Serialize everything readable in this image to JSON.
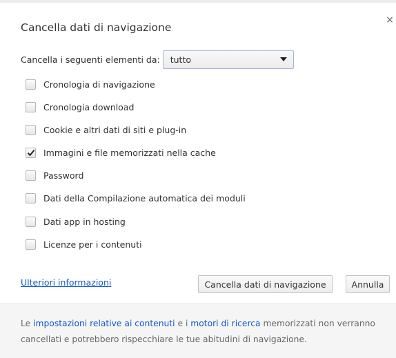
{
  "dialog": {
    "title": "Cancella dati di navigazione",
    "close_glyph": "×",
    "close_icon": "close-icon"
  },
  "period": {
    "label": "Cancella i seguenti elementi da:",
    "selected": "tutto",
    "caret_icon": "chevron-down-icon"
  },
  "options": [
    {
      "label": "Cronologia di navigazione",
      "checked": false
    },
    {
      "label": "Cronologia download",
      "checked": false
    },
    {
      "label": "Cookie e altri dati di siti e plug-in",
      "checked": false
    },
    {
      "label": "Immagini e file memorizzati nella cache",
      "checked": true
    },
    {
      "label": "Password",
      "checked": false
    },
    {
      "label": "Dati della Compilazione automatica dei moduli",
      "checked": false
    },
    {
      "label": "Dati app in hosting",
      "checked": false
    },
    {
      "label": "Licenze per i contenuti",
      "checked": false
    }
  ],
  "actions": {
    "more_info": "Ulteriori informazioni",
    "clear_button": "Cancella dati di navigazione",
    "cancel_button": "Annulla"
  },
  "footer": {
    "part1": "Le ",
    "link1": "impostazioni relative ai contenuti",
    "part2": " e i ",
    "link2": "motori di ricerca",
    "part3": " memorizzati non verranno cancellati e potrebbero rispecchiare le tue abitudini di navigazione."
  },
  "colors": {
    "link": "#1155cc",
    "footer_bg": "#f5f5f5",
    "select_border": "#a7b3d6"
  }
}
